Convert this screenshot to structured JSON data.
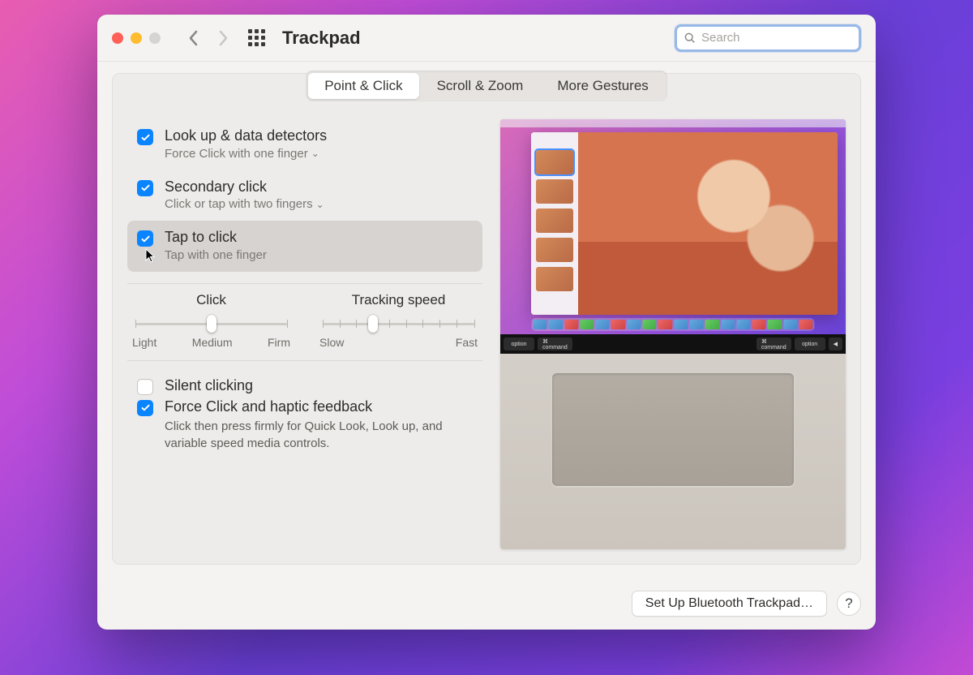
{
  "window": {
    "title": "Trackpad"
  },
  "search": {
    "placeholder": "Search",
    "value": ""
  },
  "tabs": [
    {
      "label": "Point & Click",
      "active": true
    },
    {
      "label": "Scroll & Zoom",
      "active": false
    },
    {
      "label": "More Gestures",
      "active": false
    }
  ],
  "options": {
    "lookup": {
      "title": "Look up & data detectors",
      "subtitle": "Force Click with one finger",
      "checked": true,
      "has_dropdown": true
    },
    "secondary": {
      "title": "Secondary click",
      "subtitle": "Click or tap with two fingers",
      "checked": true,
      "has_dropdown": true
    },
    "tap": {
      "title": "Tap to click",
      "subtitle": "Tap with one finger",
      "checked": true,
      "highlighted": true
    },
    "silent": {
      "title": "Silent clicking",
      "checked": false
    },
    "force": {
      "title": "Force Click and haptic feedback",
      "desc": "Click then press firmly for Quick Look, Look up, and variable speed media controls.",
      "checked": true
    }
  },
  "sliders": {
    "click": {
      "title": "Click",
      "labels": [
        "Light",
        "Medium",
        "Firm"
      ],
      "value_index": 1,
      "stops": 3
    },
    "tracking": {
      "title": "Tracking speed",
      "labels": [
        "Slow",
        "Fast"
      ],
      "value_index": 3,
      "stops": 10
    }
  },
  "footer": {
    "bluetooth_btn": "Set Up Bluetooth Trackpad…",
    "help": "?"
  }
}
